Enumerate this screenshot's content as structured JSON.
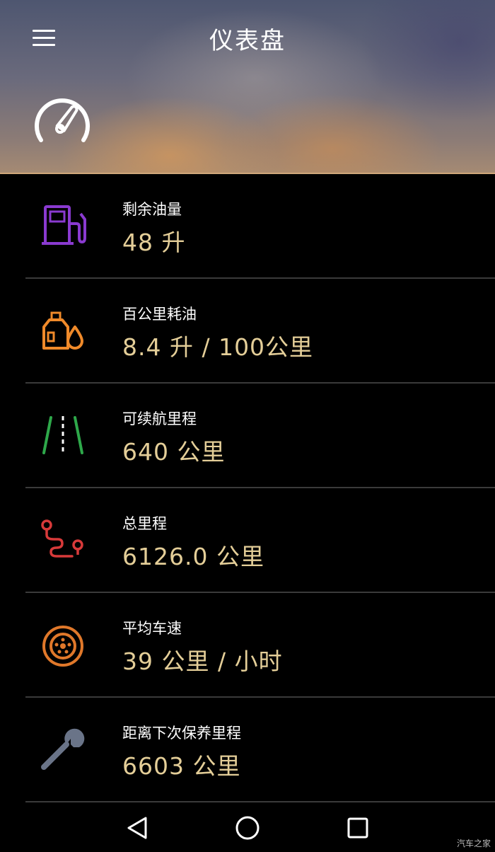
{
  "header": {
    "title": "仪表盘",
    "menu_icon": "hamburger-menu-icon",
    "gauge_icon": "speedometer-icon"
  },
  "items": [
    {
      "label": "剩余油量",
      "value": "48 升",
      "icon": "fuel-pump-icon",
      "color": "#8a3ad0"
    },
    {
      "label": "百公里耗油",
      "value": "8.4 升 / 100公里",
      "icon": "oil-can-icon",
      "color": "#f08a2a"
    },
    {
      "label": "可续航里程",
      "value": "640 公里",
      "icon": "road-icon",
      "color": "#2ea84a"
    },
    {
      "label": "总里程",
      "value": "6126.0 公里",
      "icon": "route-icon",
      "color": "#d83a3a"
    },
    {
      "label": "平均车速",
      "value": "39 公里 / 小时",
      "icon": "wheel-icon",
      "color": "#e0782a"
    },
    {
      "label": "距离下次保养里程",
      "value": "6603 公里",
      "icon": "wrench-icon",
      "color": "#6a7488"
    }
  ],
  "colors": {
    "value_text": "#e4ce98",
    "divider": "#3a3a3a"
  },
  "navbar": {
    "back_icon": "back-triangle-icon",
    "home_icon": "home-circle-icon",
    "recents_icon": "recents-square-icon"
  },
  "watermark": "汽车之家"
}
